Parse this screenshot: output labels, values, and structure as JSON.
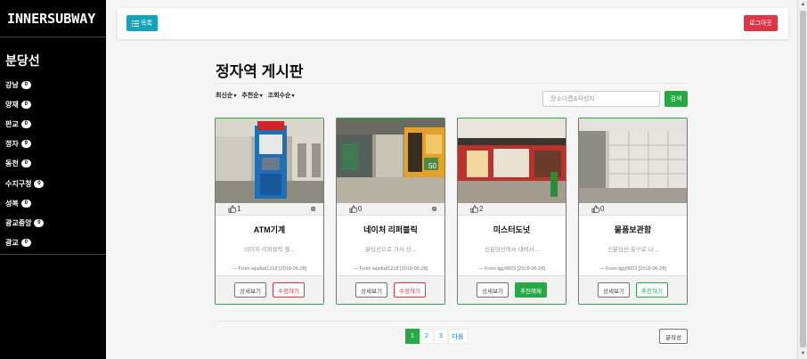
{
  "sidebar": {
    "brand": "INNERSUBWAY",
    "line_title": "분당선",
    "stations": [
      {
        "name": "강남",
        "count": "0"
      },
      {
        "name": "양재",
        "count": "0"
      },
      {
        "name": "판교",
        "count": "0"
      },
      {
        "name": "정자",
        "count": "9"
      },
      {
        "name": "동천",
        "count": "0"
      },
      {
        "name": "수지구청",
        "count": "0"
      },
      {
        "name": "성복",
        "count": "0"
      },
      {
        "name": "광교중앙",
        "count": "0"
      },
      {
        "name": "광교",
        "count": "0"
      }
    ]
  },
  "topbar": {
    "list_label": "목록",
    "logout_label": "로그아웃",
    "list_color": "#17a2b8",
    "logout_color": "#dc3545"
  },
  "main": {
    "title": "정자역 게시판",
    "sorts": [
      "최신순",
      "추천순",
      "조회수순"
    ],
    "search_placeholder": "장소이름&작성자",
    "search_label": "검색"
  },
  "cards": [
    {
      "title": "ATM기계",
      "likes": "1",
      "desc": "네이처 리퍼블릭 옆...",
      "from": "— From wjsdud1218 [2018-06-28]",
      "btn1": "상세보기",
      "btn2": "수정하기",
      "btn2_type": "edit",
      "has_delete": true,
      "image": "atm-photo"
    },
    {
      "title": "네이처 리퍼블릭",
      "likes": "0",
      "desc": "분당선으로 가서 신...",
      "from": "— From wjsdud1218 [2018-06-28]",
      "btn1": "상세보기",
      "btn2": "수정하기",
      "btn2_type": "edit",
      "has_delete": true,
      "image": "store-photo"
    },
    {
      "title": "미스터도넛",
      "likes": "2",
      "desc": "신분당선에서 내려서...",
      "from": "— From tjgy9023 [2018-06-28]",
      "btn1": "상세보기",
      "btn2": "추천해제",
      "btn2_type": "rec-on",
      "has_delete": false,
      "image": "donut-photo"
    },
    {
      "title": "물품보관함",
      "likes": "0",
      "desc": "신분당선 출구로 나...",
      "from": "— From tjgy9023 [2018-06-28]",
      "btn1": "상세보기",
      "btn2": "추천하기",
      "btn2_type": "rec",
      "has_delete": false,
      "image": "locker-photo"
    }
  ],
  "pagination": {
    "pages": [
      "1",
      "2",
      "3"
    ],
    "active": "1",
    "next_label": "다음"
  },
  "write_label": "글작성",
  "accent_color": "#28a745"
}
